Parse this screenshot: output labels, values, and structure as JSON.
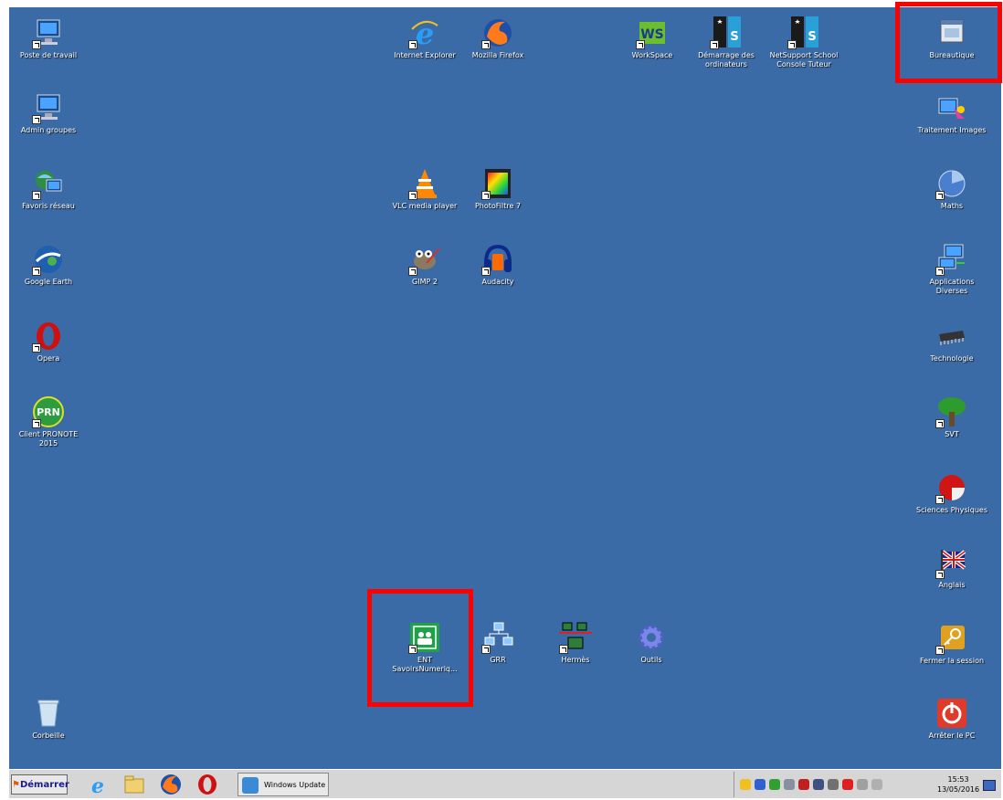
{
  "desktop": {
    "icons": [
      {
        "id": "poste-de-travail",
        "label": "Poste de travail",
        "icon": "computer-icon"
      },
      {
        "id": "admin-groupes",
        "label": "Admin groupes",
        "icon": "computer-icon"
      },
      {
        "id": "favoris-reseau",
        "label": "Favoris réseau",
        "icon": "network-globe-icon"
      },
      {
        "id": "google-earth",
        "label": "Google Earth",
        "icon": "earth-icon"
      },
      {
        "id": "opera",
        "label": "Opera",
        "icon": "opera-icon"
      },
      {
        "id": "pronote",
        "label": "Client PRONOTE\n2015",
        "icon": "pronote-icon"
      },
      {
        "id": "corbeille",
        "label": "Corbeille",
        "icon": "recycle-bin-icon"
      },
      {
        "id": "internet-explorer",
        "label": "Internet Explorer",
        "icon": "ie-icon"
      },
      {
        "id": "firefox",
        "label": "Mozilla Firefox",
        "icon": "firefox-icon"
      },
      {
        "id": "vlc",
        "label": "VLC media player",
        "icon": "vlc-cone-icon"
      },
      {
        "id": "photofiltre",
        "label": "PhotoFiltre 7",
        "icon": "photofiltre-icon"
      },
      {
        "id": "gimp",
        "label": "GIMP 2",
        "icon": "gimp-icon"
      },
      {
        "id": "audacity",
        "label": "Audacity",
        "icon": "audacity-icon"
      },
      {
        "id": "workspace",
        "label": "WorkSpace",
        "icon": "workspace-icon"
      },
      {
        "id": "demarrage",
        "label": "Démarrage des\nordinateurs",
        "icon": "netsupport-icon"
      },
      {
        "id": "netsupport",
        "label": "NetSupport School\nConsole Tuteur",
        "icon": "netsupport-icon"
      },
      {
        "id": "bureautique",
        "label": "Bureautique",
        "icon": "folder-window-icon"
      },
      {
        "id": "traitement-images",
        "label": "Traitement Images",
        "icon": "image-folder-icon"
      },
      {
        "id": "maths",
        "label": "Maths",
        "icon": "maths-icon"
      },
      {
        "id": "applications-diverses",
        "label": "Applications\nDiverses",
        "icon": "applications-icon"
      },
      {
        "id": "technologie",
        "label": "Technologie",
        "icon": "chip-icon"
      },
      {
        "id": "svt",
        "label": "SVT",
        "icon": "tree-icon"
      },
      {
        "id": "sciences-physiques",
        "label": "Sciences Physiques",
        "icon": "physics-icon"
      },
      {
        "id": "anglais",
        "label": "Anglais",
        "icon": "uk-flag-icon"
      },
      {
        "id": "fermer-session",
        "label": "Fermer la session",
        "icon": "key-icon"
      },
      {
        "id": "arreter-pc",
        "label": "Arrêter le PC",
        "icon": "power-icon"
      },
      {
        "id": "ent",
        "label": "ENT\nSavoirsNumeriq...",
        "icon": "ent-icon"
      },
      {
        "id": "grr",
        "label": "GRR",
        "icon": "grr-network-icon"
      },
      {
        "id": "hermes",
        "label": "Hermès",
        "icon": "hermes-network-icon"
      },
      {
        "id": "outils",
        "label": "Outils",
        "icon": "gear-icon"
      }
    ]
  },
  "taskbar": {
    "start_label": "Démarrer",
    "windows_update_label": "Windows Update",
    "clock_time": "15:53",
    "clock_date": "13/05/2016"
  },
  "colors": {
    "desktop": "#3b6ba6",
    "highlight": "#ff0000",
    "taskbar": "#d6d6d6"
  }
}
